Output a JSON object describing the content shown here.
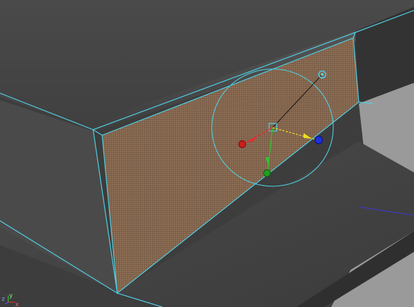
{
  "viewport": {
    "background": "#3a3a3a",
    "selection_color": "#4fd0e6",
    "face_color": "#8a6a52",
    "colors": {
      "x_axis": "#e03030",
      "y_axis": "#2ec82e",
      "z_axis": "#1e30d8",
      "pivot": "#f0e020"
    }
  },
  "axis_indicator": {
    "z_label": "z",
    "y_label": "y",
    "x_label": "x"
  },
  "manipulator": {
    "tool": "move-rotate-scale-manipulator",
    "y_handle_label": "y"
  }
}
